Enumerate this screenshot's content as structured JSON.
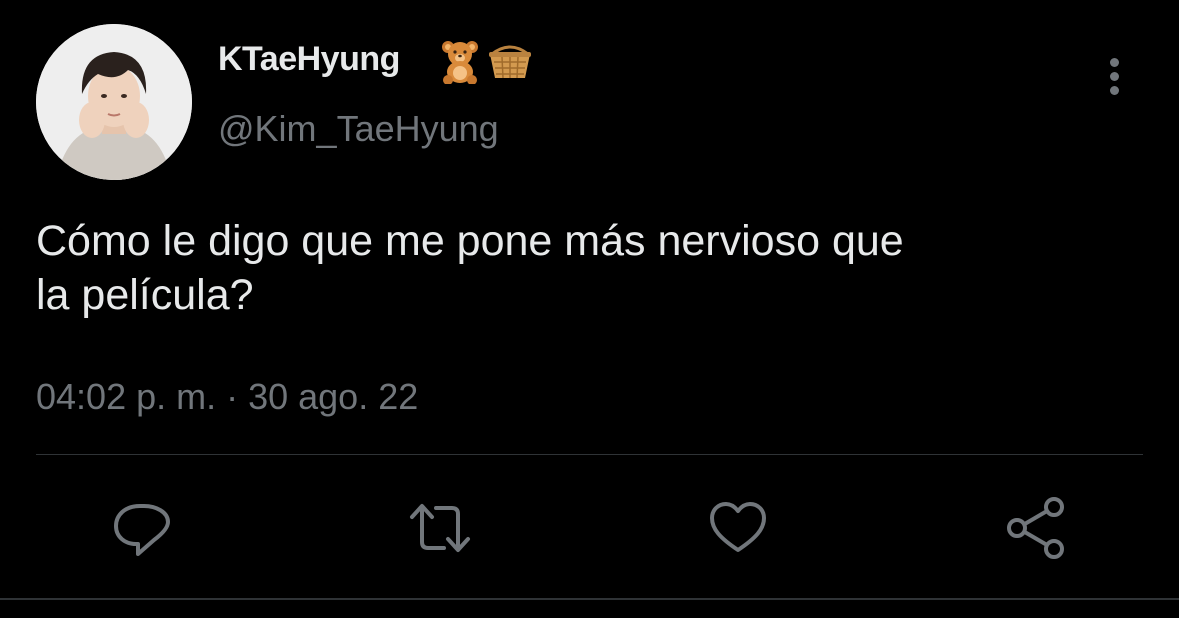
{
  "author": {
    "display_name": "KTaeHyung",
    "handle": "@Kim_TaeHyung",
    "name_emojis": [
      "teddy-bear-emoji",
      "basket-emoji"
    ]
  },
  "tweet": {
    "text": "Cómo le digo que me pone más nervioso que\nla película?",
    "timestamp": "04:02 p. m. · 30 ago. 22"
  },
  "actions": {
    "icons": [
      "reply-icon",
      "retweet-icon",
      "like-icon",
      "share-icon"
    ]
  },
  "colors": {
    "background": "#000000",
    "primary_text": "#e7e9ea",
    "secondary_text": "#71767b",
    "divider": "#2f3336"
  }
}
